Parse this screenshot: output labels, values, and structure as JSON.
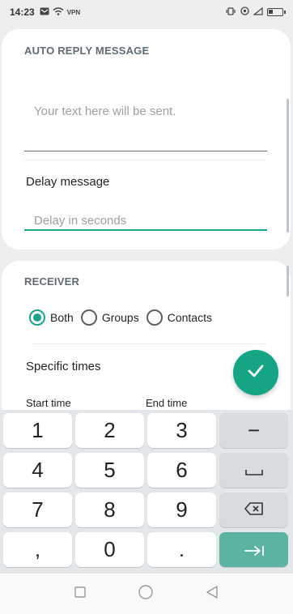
{
  "status_bar": {
    "time": "14:23",
    "left_icons": [
      "message-icon",
      "wifi-icon",
      "vpn-icon"
    ],
    "vpn_label": "VPN",
    "right_icons": [
      "vibrate-icon",
      "data-saver-icon",
      "signal-icon",
      "battery-icon"
    ],
    "battery_level": 0.35
  },
  "auto_reply": {
    "title": "AUTO REPLY MESSAGE",
    "message_placeholder": "Your text here will be sent.",
    "delay_label": "Delay message",
    "delay_placeholder": "Delay in seconds"
  },
  "receiver": {
    "title": "RECEIVER",
    "options": [
      {
        "label": "Both",
        "checked": true
      },
      {
        "label": "Groups",
        "checked": false
      },
      {
        "label": "Contacts",
        "checked": false
      }
    ],
    "specific_times_label": "Specific times",
    "start_time_label": "Start time",
    "end_time_label": "End time"
  },
  "fab": {
    "icon": "check-icon"
  },
  "keyboard": {
    "keys": [
      [
        "1",
        "2",
        "3",
        "−"
      ],
      [
        "4",
        "5",
        "6",
        "␣"
      ],
      [
        "7",
        "8",
        "9",
        "⌫"
      ],
      [
        ",",
        "0",
        ".",
        "→|"
      ]
    ]
  },
  "nav": {
    "icons": [
      "recents-icon",
      "home-icon",
      "back-icon"
    ]
  },
  "colors": {
    "accent": "#16a584",
    "enter_key": "#5bb4a2"
  }
}
